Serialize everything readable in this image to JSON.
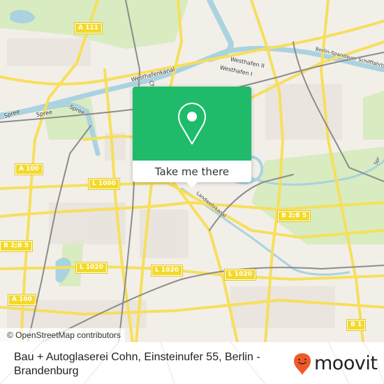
{
  "map": {
    "road_shields": [
      {
        "label": "A 111"
      },
      {
        "label": "A 100"
      },
      {
        "label": "L 1000"
      },
      {
        "label": "B 2;B 5"
      },
      {
        "label": "L 1020"
      },
      {
        "label": "L 1020"
      },
      {
        "label": "A 100"
      },
      {
        "label": "B 2;B 5"
      },
      {
        "label": "L 1020"
      },
      {
        "label": "B 1"
      }
    ],
    "labels": {
      "spree_1": "Spree",
      "spree_2": "Spree",
      "spree_3": "Spree",
      "westhafenkanal": "Westhafenkanal",
      "westhafen_2": "Westhafen II",
      "westhafen_1": "Westhafen I",
      "berlin_spandauer": "Berlin-Spandauer Schifffahrtskanal",
      "landwehrkanal": "Landwehrkanal",
      "charlottenburg": "Ch",
      "spree_east": "Spr"
    },
    "colors": {
      "land": "#f2efe9",
      "park": "#d8ebc1",
      "water": "#aad3df",
      "road": "#f6df5c",
      "rail": "#8c8c8c"
    }
  },
  "popup": {
    "icon": "location-pin-icon",
    "button_label": "Take me there",
    "color": "#1fbb6b"
  },
  "attribution": "© OpenStreetMap contributors",
  "footer": {
    "place_title": "Bau + Autoglaserei Cohn, Einsteinufer 55, Berlin - Brandenburg",
    "logo_text": "moovit",
    "logo_color": "#f05a28"
  }
}
